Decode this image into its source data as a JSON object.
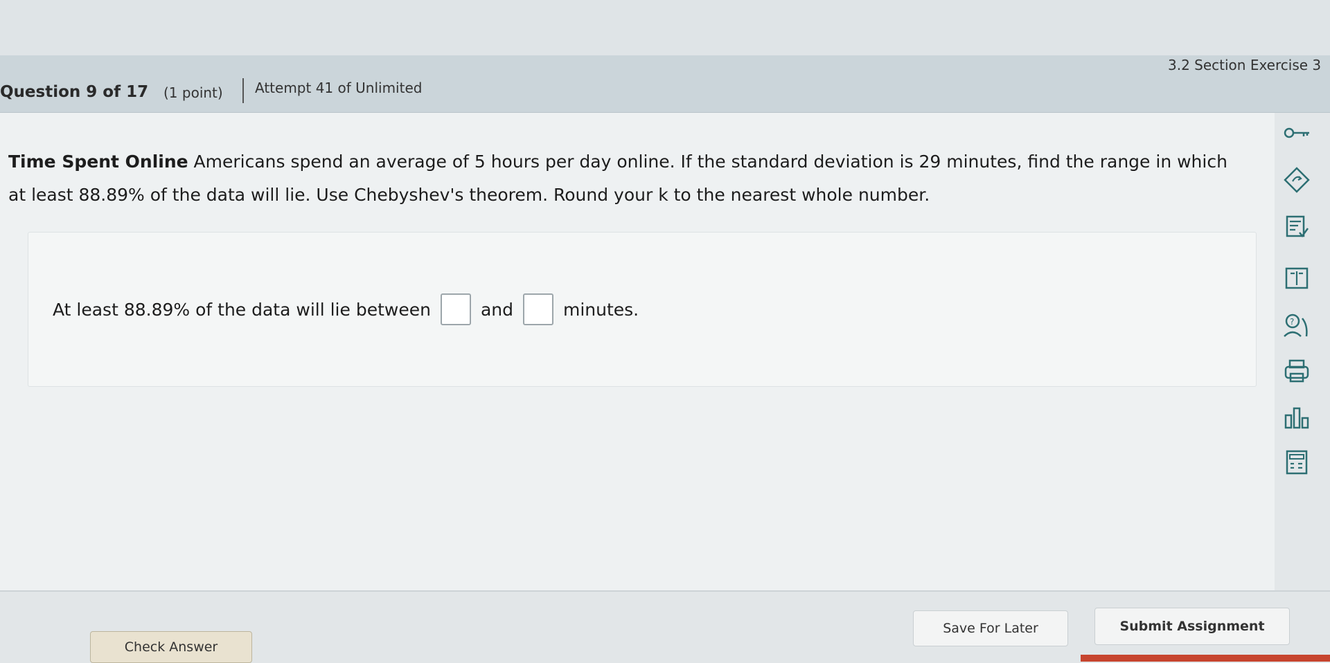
{
  "header": {
    "question_number": "Question 9 of 17",
    "points": "(1 point)",
    "attempt": "Attempt 41 of Unlimited",
    "section": "3.2 Section Exercise 3"
  },
  "question": {
    "title": "Time Spent Online",
    "text": " Americans spend an average of 5 hours per day online. If the standard deviation is 29 minutes, find the range in which at least 88.89% of the data will lie. Use Chebyshev's theorem. Round your k to the nearest whole number."
  },
  "answer": {
    "prefix": "At least 88.89% of the data will lie between",
    "middle": "and",
    "suffix": "minutes."
  },
  "sidebar": {
    "icons": [
      "key-icon",
      "navigate-icon",
      "checklist-icon",
      "textbook-icon",
      "help-tutor-icon",
      "print-icon",
      "statistics-icon",
      "calculator-icon"
    ]
  },
  "footer": {
    "check_answer": "Check Answer",
    "save_for_later": "Save For Later",
    "submit_assignment": "Submit Assignment"
  },
  "colors": {
    "accent": "#2d6f73",
    "header_bg": "#cbd5da"
  }
}
